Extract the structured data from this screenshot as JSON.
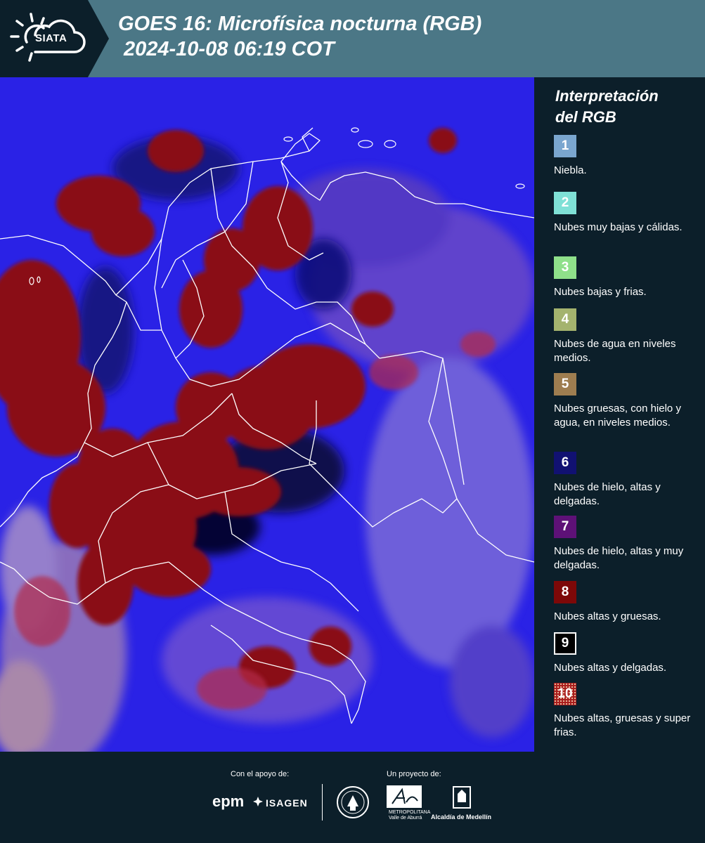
{
  "header": {
    "logo_text": "SIATA",
    "title_line1": "GOES 16: Microfísica nocturna (RGB)",
    "title_line2": "2024-10-08 06:19 COT"
  },
  "legend": {
    "title_line1": "Interpretación",
    "title_line2": "del RGB",
    "items": [
      {
        "number": "1",
        "color": "#7aa6cf",
        "text": "Niebla."
      },
      {
        "number": "2",
        "color": "#7fe0d6",
        "text": "Nubes muy bajas y cálidas."
      },
      {
        "number": "3",
        "color": "#8fe08a",
        "text": "Nubes bajas y frias."
      },
      {
        "number": "4",
        "color": "#a4b36e",
        "text": "Nubes de agua en niveles medios."
      },
      {
        "number": "5",
        "color": "#9e7d50",
        "text": "Nubes gruesas, con hielo y agua, en niveles medios."
      },
      {
        "number": "6",
        "color": "#111172",
        "text": "Nubes de hielo, altas y delgadas."
      },
      {
        "number": "7",
        "color": "#5e1177",
        "text": "Nubes de hielo, altas y muy delgadas."
      },
      {
        "number": "8",
        "color": "#7d0808",
        "text": "Nubes altas y gruesas."
      },
      {
        "number": "9",
        "color": "#000000",
        "text": "Nubes altas y delgadas."
      },
      {
        "number": "10",
        "color": "#a81c1c",
        "text": "Nubes altas, gruesas y super frias."
      }
    ]
  },
  "footer": {
    "support_label": "Con el apoyo de:",
    "project_label": "Un proyecto de:",
    "sponsors": {
      "epm": "epm",
      "isagen": "ISAGEN"
    },
    "area_line1": "METROPOLITANA",
    "area_line2": "Valle de Aburrá",
    "alcaldia": "Alcaldía de Medellín"
  },
  "colors": {
    "header_bg": "#4b7786",
    "panel_bg": "#0c1f2a",
    "map_base": "#2a22e6",
    "cloud_red": "#8a0b12"
  }
}
